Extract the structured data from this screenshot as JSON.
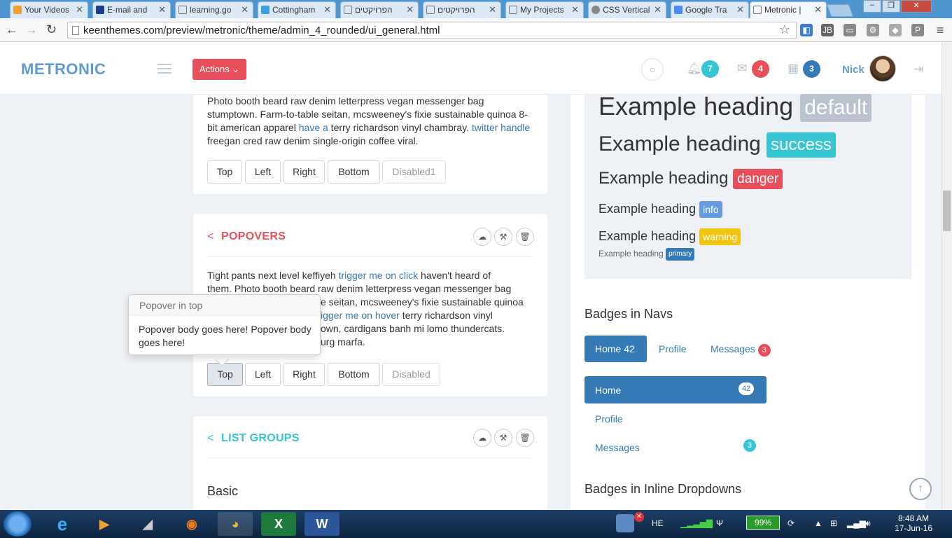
{
  "browser": {
    "tabs": [
      "Your Videos",
      "E-mail and",
      "learning.go",
      "Cottingham",
      "הפרויקטים",
      "הפרויקטים",
      "My Projects",
      "CSS Vertical",
      "Google Tra",
      "Metronic | "
    ],
    "url": "keenthemes.com/preview/metronic/theme/admin_4_rounded/ui_general.html",
    "window_controls": [
      "–",
      "❐",
      "✕"
    ]
  },
  "header": {
    "logo": "METRONIC",
    "actions_label": "Actions ⌄",
    "notifications_count": "7",
    "inbox_count": "4",
    "calendar_count": "3",
    "user_name": "Nick"
  },
  "tooltips_portlet": {
    "text_part1": "Photo booth beard raw denim letterpress vegan messenger bag stumptown. Farm-to-table seitan, mcsweeney's fixie sustainable quinoa 8-bit american apparel ",
    "link1": "have a",
    "text_part2": " terry richardson vinyl chambray. ",
    "link2": "twitter handle",
    "text_part3": " freegan cred raw denim single-origin coffee viral.",
    "buttons": [
      "Top",
      "Left",
      "Right",
      "Bottom",
      "Disabled1"
    ]
  },
  "popovers_portlet": {
    "title": "POPOVERS",
    "text_l1a": "Tight pants next level keffiyeh ",
    "text_l1_link": "trigger me on click",
    "text_l1b": " haven't heard of",
    "text_l2": "them. Photo booth beard raw denim letterpress vegan messenger bag",
    "text_l3": "e seitan, mcsweeney's fixie sustainable quinoa",
    "text_l4_link": "igger me on hover",
    "text_l4b": " terry richardson vinyl",
    "text_l5": "own, cardigans banh mi lomo thundercats.",
    "text_l6": "urg marfa.",
    "buttons": [
      "Top",
      "Left",
      "Right",
      "Bottom",
      "Disabled"
    ],
    "popover_title": "Popover in top",
    "popover_body": "Popover body goes here! Popover body goes here!"
  },
  "list_groups_portlet": {
    "title": "LIST GROUPS",
    "subtitle": "Basic"
  },
  "headings": {
    "text": "Example heading",
    "labels": [
      "default",
      "success",
      "danger",
      "info",
      "warning",
      "primary"
    ]
  },
  "badges_navs": {
    "title": "Badges in Navs",
    "tabs": [
      {
        "label": "Home",
        "badge": "42"
      },
      {
        "label": "Profile"
      },
      {
        "label": "Messages",
        "badge": "3"
      }
    ],
    "stacked": [
      {
        "label": "Home",
        "badge": "42"
      },
      {
        "label": "Profile"
      },
      {
        "label": "Messages",
        "badge": "3"
      }
    ]
  },
  "badges_inline": {
    "title": "Badges in Inline Dropdowns"
  },
  "taskbar": {
    "language": "HE",
    "battery": "99%",
    "time": "8:48 AM",
    "date": "17-Jun-16"
  },
  "colors": {
    "accent": "#337ab7",
    "danger": "#e7505a",
    "success": "#36c6d3",
    "default": "#bac3d0",
    "info": "#659be0",
    "warning": "#F1C40F",
    "primary": "#337ab7",
    "logo": "#5e9bd1",
    "popovers_title": "#e7505a",
    "list_groups_title": "#32c5d2"
  }
}
